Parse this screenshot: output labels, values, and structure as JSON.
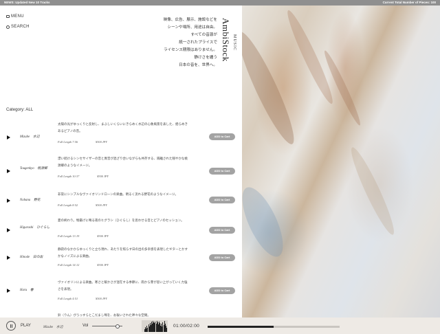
{
  "topbar": {
    "news": "NEWS: Updated New 10 Tracks",
    "total": "Current Total Number of Pieces: 100"
  },
  "nav": {
    "menu_label": "MENU",
    "search_label": "SEARCH"
  },
  "tagline": [
    "映像、広告、展示、施設などを",
    "シーンや場所、用途は自由。",
    "すべての音源が",
    "統一されたプライスで",
    "ライセンス期限はありません。",
    "静けさを纏う",
    "日本の音を、世界へ。"
  ],
  "logo": {
    "main": "AmbiStock",
    "sub": "MUSIC"
  },
  "category_label": "Category: ALL",
  "tracks": [
    {
      "name": "Mizube　水辺",
      "desc": "太陽の光がゆっくりと反射し、まぶしいくらいにきらめく水辺の心象風景を表した、揺らめきあるピアノの音。",
      "length": "Full Length 7:56",
      "price": "¥300 JPY",
      "cart": "ADD to Cart"
    },
    {
      "name": "Tougenkyo　桃源郷",
      "desc": "漂い続けるシンセサイザーの音と異音が混ざり合いながらも共存する、隔離された穏やかな桃源郷のようなイメージ。",
      "length": "Full Length 10:37",
      "price": "¥300 JPY",
      "cart": "ADD to Cart"
    },
    {
      "name": "Nobana　野花",
      "desc": "非常にシンプルなヴァイオリンドローンの楽曲。明るく流れる野花のようなイメージ。",
      "length": "Full Length 8:52",
      "price": "¥300 JPY",
      "cart": "ADD to Cart"
    },
    {
      "name": "Higurashi　ひぐらし",
      "desc": "夏の終わり。物憂げに鳴る夜のヒグラシ（ひぐらし）を思わせる音とピアノのセッション。",
      "length": "Full Length 13:19",
      "price": "¥300 JPY",
      "cart": "ADD to Cart"
    },
    {
      "name": "Hinode　日の出",
      "desc": "静寂のなかからゆっくりと立ち現れ、あたりを照らす日の出の多幸感を表現したギターとかすかなノイズによる楽曲。",
      "length": "Full Length 14:12",
      "price": "¥300 JPY",
      "cart": "ADD to Cart"
    },
    {
      "name": "Haru　春",
      "desc": "ヴァイオリンによる楽曲。寒さと暖かさが混在する季節に、雨から芽が思い上がっていく力強さを表現。",
      "length": "Full Length 4:51",
      "price": "¥300 JPY",
      "cart": "ADD to Cart"
    },
    {
      "name": "",
      "desc": "鈴（りん）がうっすらとこだまし鳴を、お祓いされた神々な空間。",
      "length": "",
      "price": "",
      "cart": ""
    }
  ],
  "player": {
    "play_label": "PLAY",
    "current_track": "Mizube　水辺",
    "vol_label": "Vol",
    "time": "01:00/02:00",
    "progress": 0.5,
    "volume": 0.85
  }
}
